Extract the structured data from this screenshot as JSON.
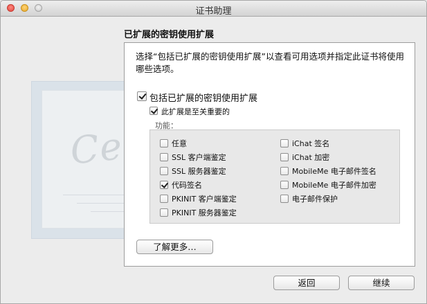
{
  "window": {
    "title": "证书助理"
  },
  "heading": "已扩展的密钥使用扩展",
  "description": "选择“包括已扩展的密钥使用扩展”以查看可用选项并指定此证书将使用哪些选项。",
  "include_option": {
    "label": "包括已扩展的密钥使用扩展",
    "checked": true
  },
  "critical_option": {
    "label": "此扩展是至关重要的",
    "checked": true
  },
  "capabilities_label": "功能：",
  "capabilities_left": [
    {
      "label": "任意",
      "checked": false
    },
    {
      "label": "SSL 客户端鉴定",
      "checked": false
    },
    {
      "label": "SSL 服务器鉴定",
      "checked": false
    },
    {
      "label": "代码签名",
      "checked": true
    },
    {
      "label": "PKINIT 客户端鉴定",
      "checked": false
    },
    {
      "label": "PKINIT 服务器鉴定",
      "checked": false
    }
  ],
  "capabilities_right": [
    {
      "label": "iChat 签名",
      "checked": false
    },
    {
      "label": "iChat 加密",
      "checked": false
    },
    {
      "label": "MobileMe 电子邮件签名",
      "checked": false
    },
    {
      "label": "MobileMe 电子邮件加密",
      "checked": false
    },
    {
      "label": "电子邮件保护",
      "checked": false
    }
  ],
  "learn_more_button": "了解更多…",
  "back_button": "返回",
  "continue_button": "继续",
  "watermark": {
    "text": "Certificate"
  }
}
